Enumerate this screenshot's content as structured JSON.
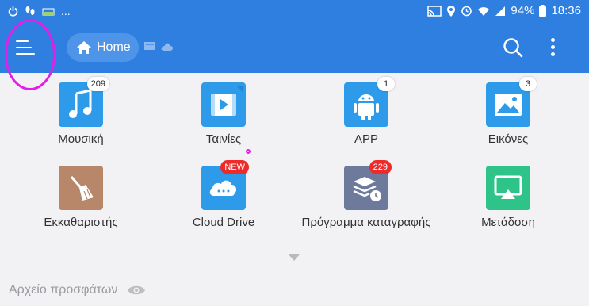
{
  "statusbar": {
    "battery": "94%",
    "time": "18:36",
    "dots": "..."
  },
  "toolbar": {
    "home_label": "Home"
  },
  "grid": [
    {
      "label": "Μουσική",
      "badge": "209",
      "icon": "music-icon",
      "color": "#2d9bea"
    },
    {
      "label": "Ταινίες",
      "badge": "",
      "icon": "video-icon",
      "color": "#2d9bea"
    },
    {
      "label": "APP",
      "badge": "1",
      "icon": "android-icon",
      "color": "#2d9bea"
    },
    {
      "label": "Εικόνες",
      "badge": "3",
      "icon": "image-icon",
      "color": "#2d9bea"
    },
    {
      "label": "Εκκαθαριστής",
      "badge": "",
      "icon": "broom-icon",
      "color": "#b8876a"
    },
    {
      "label": "Cloud Drive",
      "badge": "NEW",
      "icon": "cloud-icon",
      "color": "#2d9bea"
    },
    {
      "label": "Πρόγραμμα καταγραφής",
      "badge": "229",
      "icon": "log-stack-icon",
      "color": "#6d7a9c"
    },
    {
      "label": "Μετάδοση",
      "badge": "",
      "icon": "cast-icon",
      "color": "#2ec489"
    }
  ],
  "recent": {
    "label": "Αρχείο προσφάτων"
  },
  "colors": {
    "primary": "#2f7fe0",
    "annotation": "#e020e8",
    "badge_red": "#ee2b2b"
  }
}
